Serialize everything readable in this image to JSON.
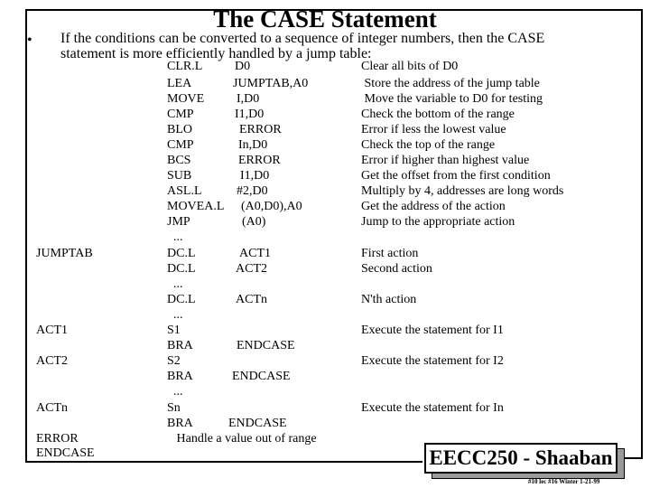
{
  "title": "The CASE Statement",
  "bullet": "•",
  "intro": [
    "If the conditions can be converted to a sequence of integer numbers, then the CASE",
    "statement is more efficiently handled by  a jump table:"
  ],
  "rows": [
    {
      "label": "",
      "mnemonic": "CLR.L",
      "operand": "D0",
      "comment": "Clear all bits of D0"
    },
    {
      "label": "",
      "mnemonic": "LEA",
      "operand": "JUMPTAB,A0",
      "comment": " Store the address of the jump table"
    },
    {
      "label": "",
      "mnemonic": "MOVE",
      "operand": "I,D0",
      "comment": " Move the variable to D0 for testing"
    },
    {
      "label": "",
      "mnemonic": "CMP",
      "operand": "I1,D0",
      "comment": "Check the bottom of the range"
    },
    {
      "label": "",
      "mnemonic": "BLO",
      "operand": "ERROR",
      "comment": "Error if less the lowest value"
    },
    {
      "label": "",
      "mnemonic": "CMP",
      "operand": "In,D0",
      "comment": "Check the top of the range"
    },
    {
      "label": "",
      "mnemonic": "BCS",
      "operand": "ERROR",
      "comment": "Error if higher than highest value"
    },
    {
      "label": "",
      "mnemonic": "SUB",
      "operand": "I1,D0",
      "comment": "Get the offset from the first condition"
    },
    {
      "label": "",
      "mnemonic": "ASL.L",
      "operand": "#2,D0",
      "comment": "Multiply by 4, addresses are long words"
    },
    {
      "label": "",
      "mnemonic": "MOVEA.L",
      "operand": "(A0,D0),A0",
      "comment": "Get the address of the action"
    },
    {
      "label": "",
      "mnemonic": "JMP",
      "operand": "(A0)",
      "comment": "Jump to the appropriate action"
    },
    {
      "label": "",
      "mnemonic": "  ...",
      "operand": "",
      "comment": ""
    },
    {
      "label": "JUMPTAB",
      "mnemonic": "DC.L",
      "operand": "ACT1",
      "comment": "First action"
    },
    {
      "label": "",
      "mnemonic": "DC.L",
      "operand": "ACT2",
      "comment": "Second action"
    },
    {
      "label": "",
      "mnemonic": "  ...",
      "operand": "",
      "comment": ""
    },
    {
      "label": "",
      "mnemonic": "DC.L",
      "operand": "ACTn",
      "comment": "N'th action"
    },
    {
      "label": "",
      "mnemonic": "  ...",
      "operand": "",
      "comment": ""
    },
    {
      "label": "ACT1",
      "mnemonic": "S1",
      "operand": "",
      "comment": "Execute the statement for I1"
    },
    {
      "label": "",
      "mnemonic": "BRA",
      "operand": "ENDCASE",
      "comment": ""
    },
    {
      "label": "ACT2",
      "mnemonic": "S2",
      "operand": "",
      "comment": "Execute the statement for I2"
    },
    {
      "label": "",
      "mnemonic": "BRA",
      "operand": "ENDCASE",
      "comment": ""
    },
    {
      "label": "",
      "mnemonic": "  ...",
      "operand": "",
      "comment": ""
    },
    {
      "label": "ACTn",
      "mnemonic": "Sn",
      "operand": "",
      "comment": "Execute the statement for In"
    },
    {
      "label": "",
      "mnemonic": "BRA",
      "operand": "ENDCASE",
      "comment": ""
    },
    {
      "label": "ERROR",
      "mnemonic": "   Handle a value out of range",
      "operand": "",
      "comment": ""
    },
    {
      "label": "ENDCASE",
      "mnemonic": "",
      "operand": "",
      "comment": ""
    }
  ],
  "badge": "EECC250 - Shaaban",
  "footer": "#10 lec #16  Winter 1-21-99"
}
